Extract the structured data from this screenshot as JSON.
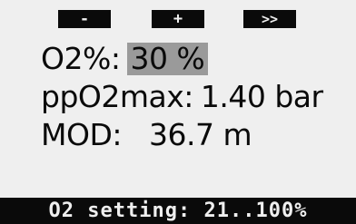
{
  "softkeys": {
    "left": "-",
    "center": "+",
    "right": ">>"
  },
  "o2": {
    "label": "O2%:",
    "value": "30 %"
  },
  "ppo2max": {
    "label": "ppO2max:",
    "value": "1.40 bar"
  },
  "mod": {
    "label": "MOD:",
    "value": "36.7 m"
  },
  "status": {
    "text": "O2 setting: 21..100%"
  },
  "colors": {
    "background": "#efefef",
    "foreground": "#0a0a0a",
    "highlight": "#9a9a9a"
  }
}
